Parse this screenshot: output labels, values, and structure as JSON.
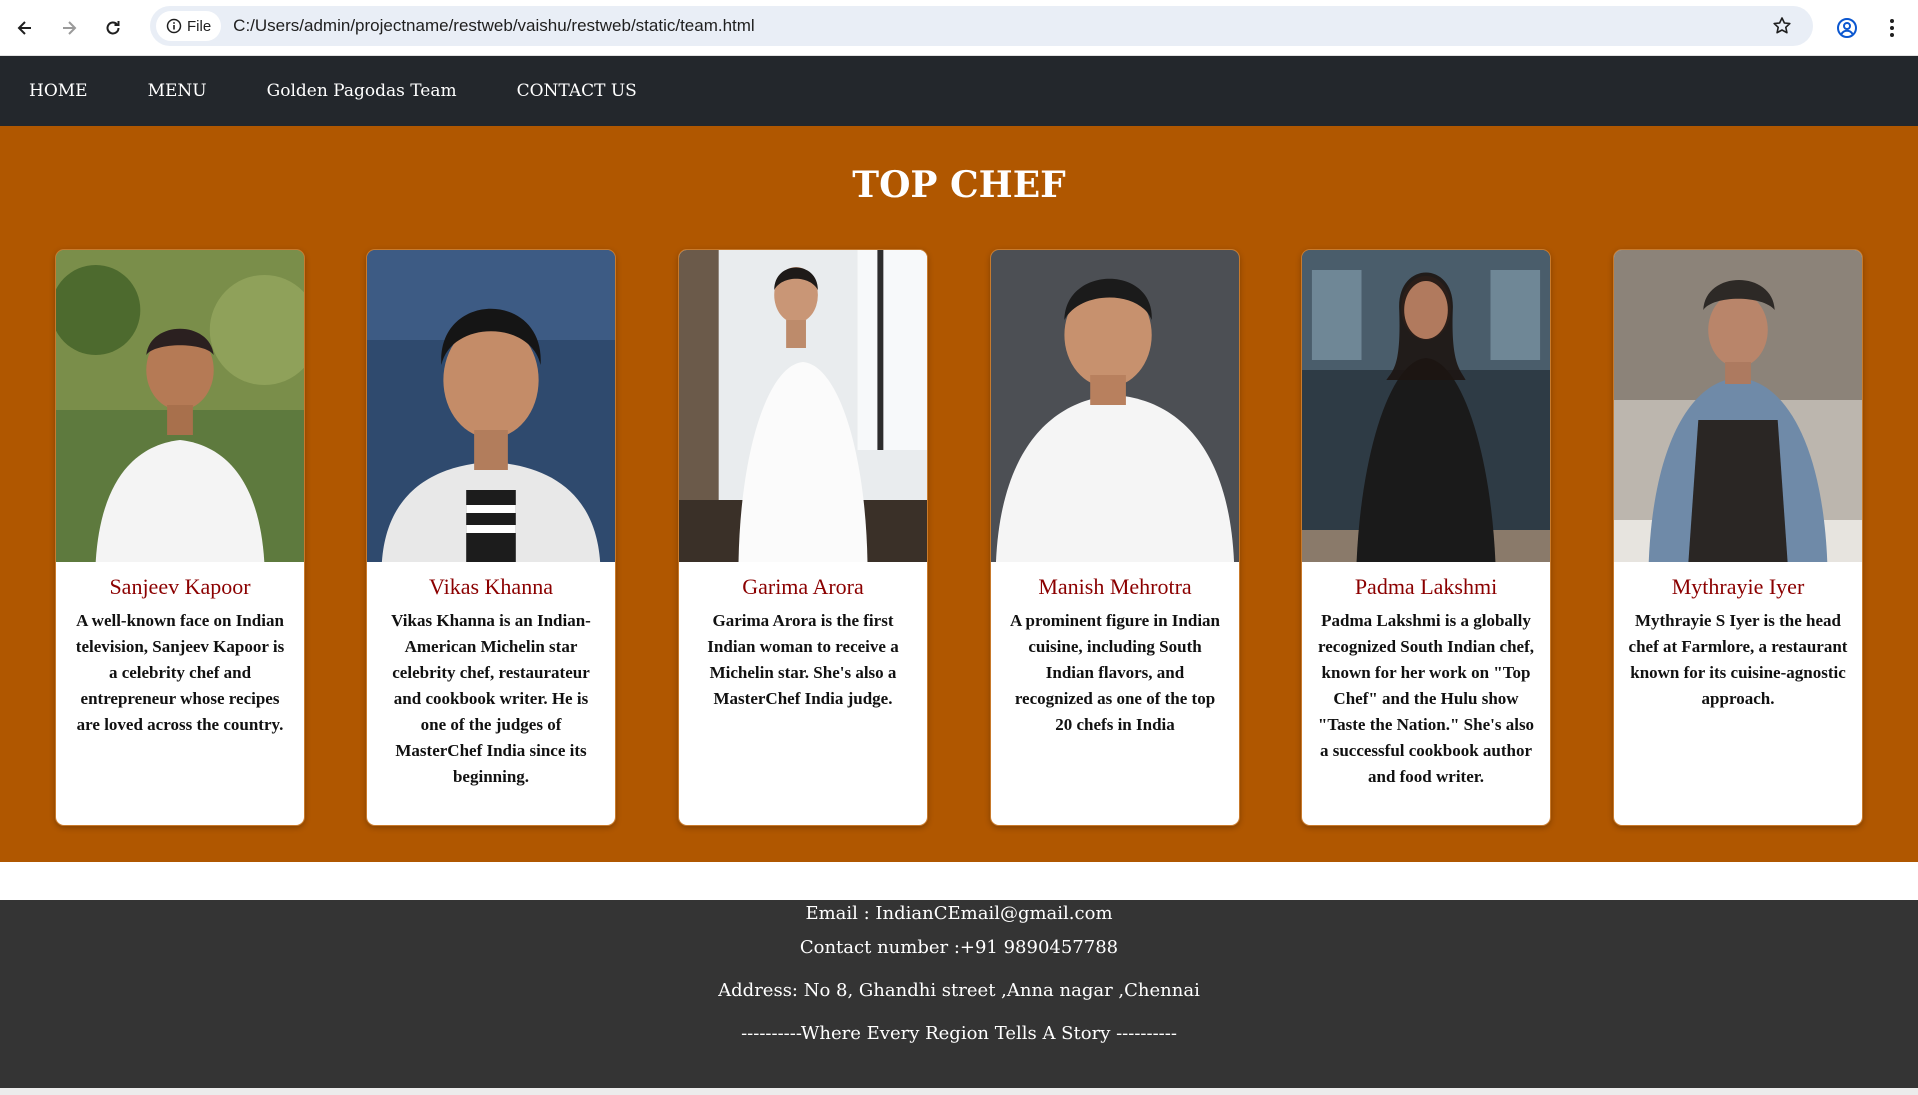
{
  "browser": {
    "file_label": "File",
    "url": "C:/Users/admin/projectname/restweb/vaishu/restweb/static/team.html",
    "icons": [
      "back-arrow-icon",
      "forward-arrow-icon",
      "reload-icon",
      "info-icon",
      "star-icon",
      "profile-icon",
      "kebab-menu-icon"
    ]
  },
  "nav": {
    "items": [
      "HOME",
      "MENU",
      "Golden Pagodas Team",
      "CONTACT US"
    ]
  },
  "section": {
    "title": "TOP CHEF",
    "background": "#b05700"
  },
  "chefs": [
    {
      "name": "Sanjeev Kapoor",
      "description": "A well-known face on Indian television, Sanjeev Kapoor is a celebrity chef and entrepreneur whose recipes are loved across the country."
    },
    {
      "name": "Vikas Khanna",
      "description": "Vikas Khanna is an Indian-American Michelin star celebrity chef, restaurateur and cookbook writer. He is one of the judges of MasterChef India since its beginning."
    },
    {
      "name": "Garima Arora",
      "description": "Garima Arora is the first Indian woman to receive a Michelin star. She's also a MasterChef India judge."
    },
    {
      "name": "Manish Mehrotra",
      "description": "A prominent figure in Indian cuisine, including South Indian flavors, and recognized as one of the top 20 chefs in India"
    },
    {
      "name": "Padma Lakshmi",
      "description": "Padma Lakshmi is a globally recognized South Indian chef, known for her work on \"Top Chef\" and the Hulu show \"Taste the Nation.\" She's also a successful cookbook author and food writer."
    },
    {
      "name": "Mythrayie Iyer",
      "description": "Mythrayie S Iyer is the head chef at Farmlore, a restaurant known for its cuisine-agnostic approach."
    }
  ],
  "footer": {
    "email": "Email : IndianCEmail@gmail.com",
    "contact": "Contact number :+91 9890457788",
    "address": "Address: No 8, Ghandhi street ,Anna nagar ,Chennai",
    "tagline": "----------Where Every Region Tells A Story ----------"
  }
}
